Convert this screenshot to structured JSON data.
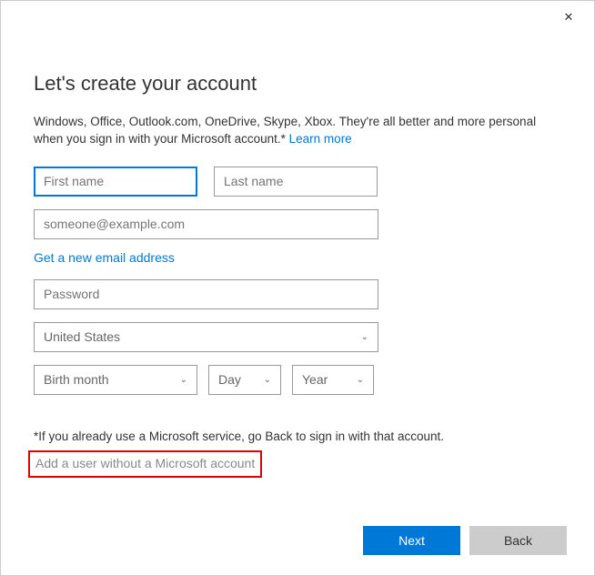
{
  "title": "Let's create your account",
  "description": {
    "text": "Windows, Office, Outlook.com, OneDrive, Skype, Xbox. They're all better and more personal when you sign in with your Microsoft account.*",
    "learn_more": "Learn more"
  },
  "fields": {
    "first_name": {
      "placeholder": "First name",
      "value": ""
    },
    "last_name": {
      "placeholder": "Last name",
      "value": ""
    },
    "email": {
      "placeholder": "someone@example.com",
      "value": ""
    },
    "password": {
      "placeholder": "Password",
      "value": ""
    }
  },
  "links": {
    "new_email": "Get a new email address",
    "alt_user": "Add a user without a Microsoft account"
  },
  "country": {
    "selected": "United States"
  },
  "birth": {
    "month": "Birth month",
    "day": "Day",
    "year": "Year"
  },
  "footer_note": "*If you already use a Microsoft service, go Back to sign in with that account.",
  "buttons": {
    "next": "Next",
    "back": "Back"
  }
}
